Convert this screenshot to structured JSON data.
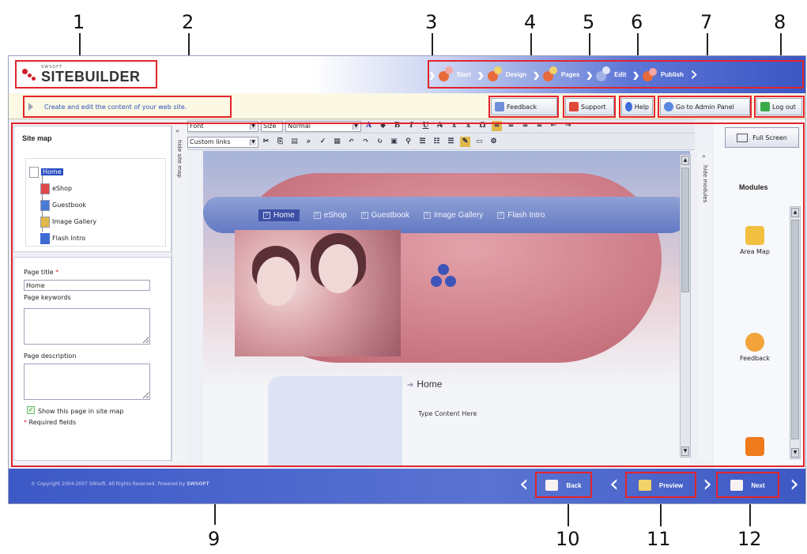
{
  "callouts": [
    "1",
    "2",
    "3",
    "4",
    "5",
    "6",
    "7",
    "8",
    "9",
    "10",
    "11",
    "12"
  ],
  "header": {
    "logo_small": "SWSOFT",
    "logo_main": "SITEBUILDER",
    "steps": [
      "Start",
      "Design",
      "Pages",
      "Edit",
      "Publish"
    ]
  },
  "infobar": {
    "hint": "Create and edit the content of your web site.",
    "buttons": {
      "feedback": "Feedback",
      "support": "Support",
      "help": "Help",
      "admin": "Go to Admin Panel",
      "logout": "Log out"
    }
  },
  "sidebar": {
    "title": "Site map",
    "tree": [
      "Home",
      "eShop",
      "Guestbook",
      "Image Gallery",
      "Flash Intro"
    ],
    "page_title_label": "Page title",
    "page_title_value": "Home",
    "keywords_label": "Page keywords",
    "description_label": "Page description",
    "show_in_map_label": "Show this page in site map",
    "required_label": "Required fields",
    "hide_label": "hide site map"
  },
  "editor": {
    "font_select": "Font",
    "size_select": "Size",
    "format_select": "Normal",
    "links_select": "Custom links",
    "nav_items": [
      "Home",
      "eShop",
      "Guestbook",
      "Image Gallery",
      "Flash Intro"
    ],
    "content_title": "Home",
    "content_placeholder": "Type Content Here"
  },
  "modules": {
    "fullscreen_label": "Full Screen",
    "title": "Modules",
    "hide_label": "hide modules",
    "items": [
      "Area Map",
      "Feedback"
    ]
  },
  "footer": {
    "copyright": "© Copyright 2004-2007 SWsoft. All Rights Reserved.   Powered by",
    "powered_brand": "SWSOFT",
    "back": "Back",
    "preview": "Preview",
    "next": "Next"
  },
  "colors": {
    "highlight": "#e3242b",
    "brand_blue": "#3b56c3",
    "logo_red": "#d01f2e"
  }
}
